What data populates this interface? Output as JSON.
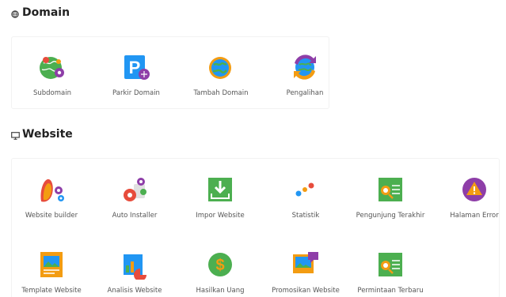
{
  "domain_section": {
    "title": "Domain",
    "items": [
      {
        "label": "Subdomain",
        "icon": "subdomain-globe-icon"
      },
      {
        "label": "Parkir Domain",
        "icon": "parked-domain-icon"
      },
      {
        "label": "Tambah Domain",
        "icon": "addon-domain-globe-icon"
      },
      {
        "label": "Pengalihan",
        "icon": "redirect-icon"
      }
    ]
  },
  "website_section": {
    "title": "Website",
    "items": [
      {
        "label": "Website builder",
        "icon": "website-builder-icon"
      },
      {
        "label": "Auto Installer",
        "icon": "auto-installer-gears-icon"
      },
      {
        "label": "Impor Website",
        "icon": "import-website-icon"
      },
      {
        "label": "Statistik",
        "icon": "statistics-dots-icon"
      },
      {
        "label": "Pengunjung Terakhir",
        "icon": "latest-visitors-icon"
      },
      {
        "label": "Halaman Error",
        "icon": "error-page-warning-icon"
      },
      {
        "label": "Template Website",
        "icon": "template-website-icon"
      },
      {
        "label": "Analisis Website",
        "icon": "website-analysis-icon"
      },
      {
        "label": "Hasilkan Uang",
        "icon": "make-money-dollar-icon"
      },
      {
        "label": "Promosikan Website",
        "icon": "promote-website-icon"
      },
      {
        "label": "Permintaan Terbaru",
        "icon": "latest-requests-icon"
      }
    ]
  },
  "colors": {
    "green": "#4caf50",
    "blue": "#2196f3",
    "purple": "#8e3ea8",
    "orange": "#f39c12",
    "red": "#e74c3c"
  }
}
